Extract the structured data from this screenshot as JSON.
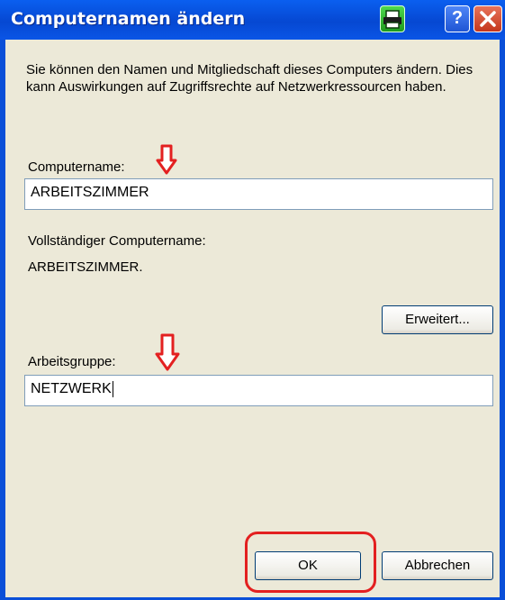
{
  "window": {
    "title": "Computernamen ändern"
  },
  "titlebar": {
    "help_label": "?"
  },
  "dialog": {
    "description": "Sie können den Namen und Mitgliedschaft dieses Computers ändern. Dies kann Auswirkungen auf Zugriffsrechte auf Netzwerkressourcen haben.",
    "computer_name_label": "Computername:",
    "computer_name_value": "ARBEITSZIMMER",
    "full_name_label": "Vollständiger Computername:",
    "full_name_value": "ARBEITSZIMMER.",
    "advanced_button": "Erweitert...",
    "workgroup_label": "Arbeitsgruppe:",
    "workgroup_value": "NETZWERK",
    "ok_button": "OK",
    "cancel_button": "Abbrechen"
  },
  "colors": {
    "titlebar": "#0a55e6",
    "dialog_background": "#ece9d8",
    "annotation": "#e32020"
  },
  "icons": [
    "printer-icon",
    "help-icon",
    "close-icon",
    "down-arrow-annotation-icon"
  ]
}
